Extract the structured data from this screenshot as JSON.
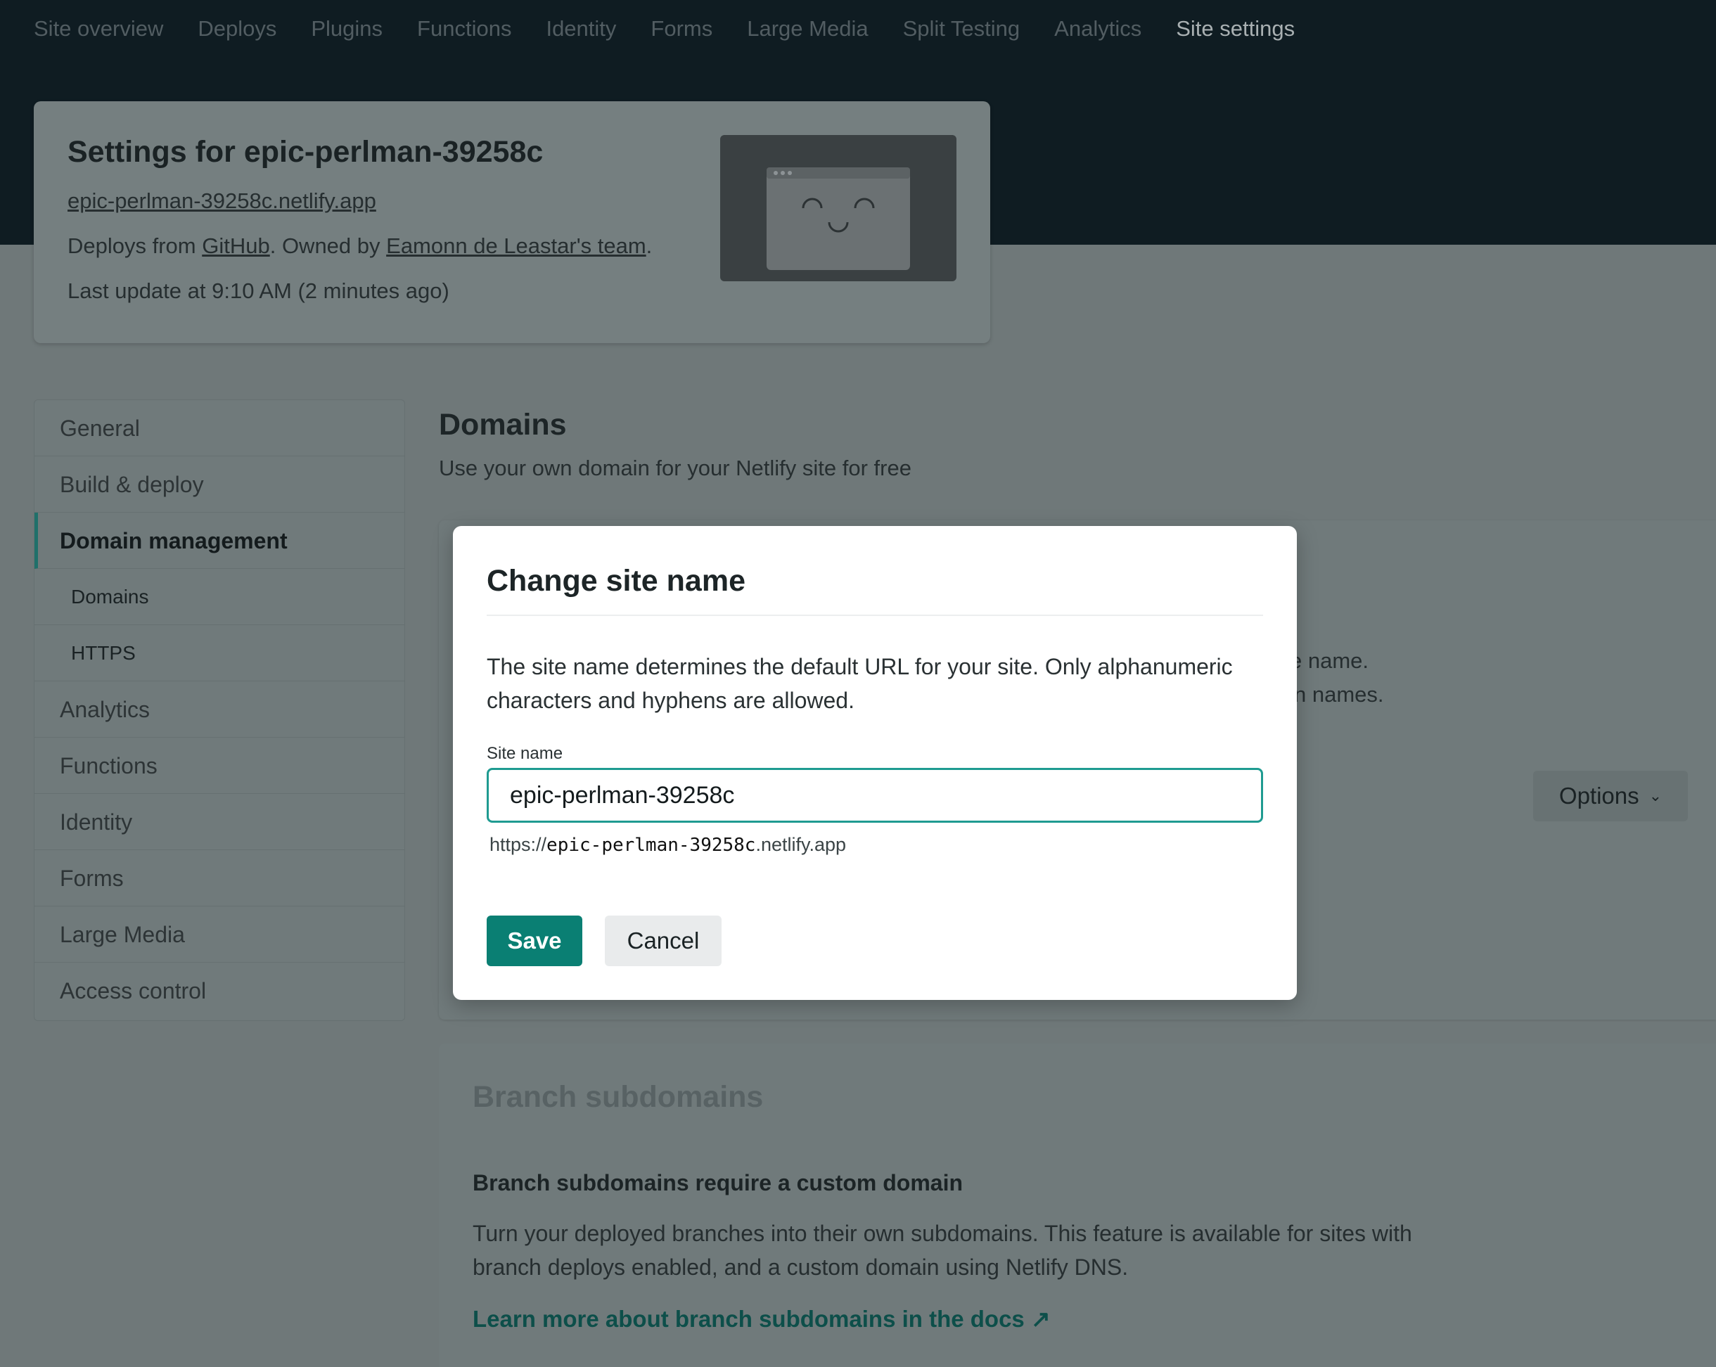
{
  "topnav": {
    "items": [
      {
        "label": "Site overview"
      },
      {
        "label": "Deploys"
      },
      {
        "label": "Plugins"
      },
      {
        "label": "Functions"
      },
      {
        "label": "Identity"
      },
      {
        "label": "Forms"
      },
      {
        "label": "Large Media"
      },
      {
        "label": "Split Testing"
      },
      {
        "label": "Analytics"
      },
      {
        "label": "Site settings",
        "active": true
      }
    ]
  },
  "site_card": {
    "title": "Settings for epic-perlman-39258c",
    "url": "epic-perlman-39258c.netlify.app",
    "deploys_prefix": "Deploys from ",
    "deploys_source": "GitHub",
    "owned_prefix": ". Owned by ",
    "owner": "Eamonn de Leastar's team",
    "owner_suffix": ".",
    "last_update": "Last update at 9:10 AM (2 minutes ago)"
  },
  "sidebar": {
    "items": [
      {
        "label": "General"
      },
      {
        "label": "Build & deploy"
      },
      {
        "label": "Domain management",
        "active": true
      },
      {
        "label": "Domains",
        "sub": true
      },
      {
        "label": "HTTPS",
        "sub": true
      },
      {
        "label": "Analytics"
      },
      {
        "label": "Functions"
      },
      {
        "label": "Identity"
      },
      {
        "label": "Forms"
      },
      {
        "label": "Large Media"
      },
      {
        "label": "Access control"
      }
    ]
  },
  "main": {
    "title": "Domains",
    "subtitle": "Use your own domain for your Netlify site for free",
    "partial_line1": "e name.",
    "partial_line2": "n names.",
    "options_label": "Options"
  },
  "branch": {
    "title": "Branch subdomains",
    "subtitle": "Branch subdomains require a custom domain",
    "description": "Turn your deployed branches into their own subdomains. This feature is available for sites with branch deploys enabled, and a custom domain using Netlify DNS.",
    "link": "Learn more about branch subdomains in the docs ↗"
  },
  "modal": {
    "title": "Change site name",
    "description": "The site name determines the default URL for your site. Only alphanumeric characters and hyphens are allowed.",
    "field_label": "Site name",
    "field_value": "epic-perlman-39258c",
    "preview_prefix": "https://",
    "preview_name": "epic-perlman-39258c",
    "preview_suffix": ".netlify.app",
    "save_label": "Save",
    "cancel_label": "Cancel"
  },
  "colors": {
    "brand_teal": "#0a7f73",
    "focus_ring": "#1f9b91",
    "top_band": "#0f1c22"
  },
  "icons": {
    "site_thumbnail": "browser-window-smiley-icon",
    "options_chevron": "chevron-down-icon",
    "external_link": "arrow-up-right-icon"
  }
}
